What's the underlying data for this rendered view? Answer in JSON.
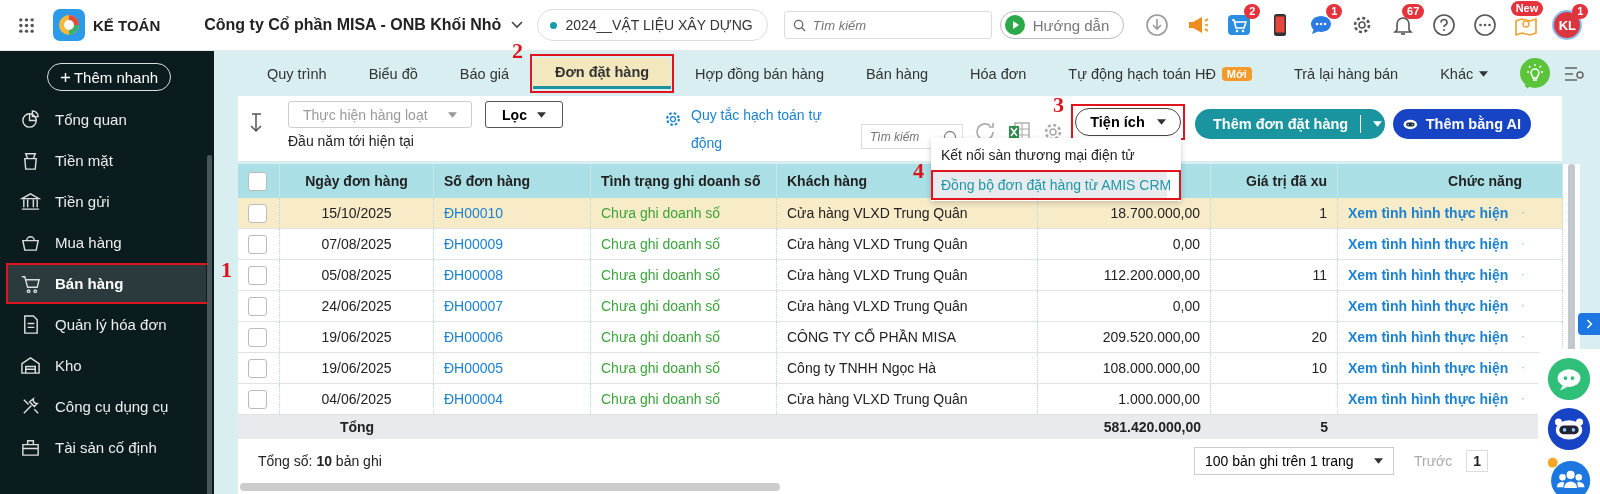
{
  "top_bar": {
    "app_name": "KẾ TOÁN",
    "company": "Công ty Cổ phần MISA - ONB Khối Nhỏ",
    "database": "2024__VẬT LIỆU XÂY DỰNG",
    "search": {
      "placeholder": "Tìm kiếm"
    },
    "guide_button": "Hướng dẫn",
    "icons": [
      {
        "kind": "download"
      },
      {
        "kind": "megaphone"
      },
      {
        "kind": "cart",
        "badge": "2"
      },
      {
        "kind": "phone"
      },
      {
        "kind": "chat",
        "badge": "1"
      },
      {
        "kind": "settings"
      },
      {
        "kind": "bell",
        "badge": "67"
      },
      {
        "kind": "help"
      },
      {
        "kind": "more"
      },
      {
        "kind": "map",
        "badge": "New"
      }
    ],
    "avatar": {
      "initials": "KL",
      "badge": "1"
    }
  },
  "sidebar": {
    "quick_add": "Thêm nhanh",
    "items": [
      {
        "label": "Tổng quan",
        "selected": false
      },
      {
        "label": "Tiền mặt",
        "selected": false
      },
      {
        "label": "Tiền gửi",
        "selected": false
      },
      {
        "label": "Mua hàng",
        "selected": false
      },
      {
        "label": "Bán hàng",
        "selected": true,
        "callout": "1"
      },
      {
        "label": "Quản lý hóa đơn",
        "selected": false
      },
      {
        "label": "Kho",
        "selected": false
      },
      {
        "label": "Công cụ dụng cụ",
        "selected": false
      },
      {
        "label": "Tài sản cố định",
        "selected": false
      }
    ]
  },
  "tabs": [
    {
      "label": "Quy trình",
      "kind": "tab",
      "selected": false
    },
    {
      "label": "Biểu đồ",
      "kind": "tab",
      "selected": false
    },
    {
      "label": "Báo giá",
      "kind": "tab",
      "selected": false
    },
    {
      "label": "Đơn đặt hàng",
      "kind": "tab",
      "selected": true,
      "callout": "2"
    },
    {
      "label": "Hợp đồng bán hàng",
      "kind": "tab",
      "selected": false
    },
    {
      "label": "Bán hàng",
      "kind": "tab",
      "selected": false
    },
    {
      "label": "Hóa đơn",
      "kind": "tab",
      "selected": false
    },
    {
      "label": "Tự động hạch toán HĐ",
      "kind": "tab",
      "selected": false,
      "badge": "Mới"
    },
    {
      "label": "Trả lại hàng bán",
      "kind": "tab",
      "selected": false
    },
    {
      "label": "Khác",
      "kind": "dropdown",
      "selected": false
    }
  ],
  "toolbar": {
    "bulk_action": {
      "label": "Thực hiện hàng loạt",
      "disabled": true
    },
    "filter": "Lọc",
    "period": "Đầu năm tới hiện tại",
    "rules_link": "Quy tắc hạch toán tự động",
    "search": {
      "placeholder": "Tìm kiếm"
    },
    "utilities": {
      "label": "Tiện ích",
      "callout": "3"
    },
    "add_button": "Thêm đơn đặt hàng",
    "ai_button": "Thêm bằng AI"
  },
  "utilities_menu": [
    {
      "label": "Kết nối sàn thương mại điện tử",
      "selected": false
    },
    {
      "label": "Đồng bộ đơn đặt hàng từ AMIS CRM",
      "selected": true,
      "callout": "4"
    }
  ],
  "table": {
    "header_checked": false,
    "columns": [
      {
        "label": "Ngày đơn hàng"
      },
      {
        "label": "Số đơn hàng"
      },
      {
        "label": "Tình trạng ghi doanh số"
      },
      {
        "label": "Khách hàng"
      },
      {},
      {
        "label": "Giá trị đã xu"
      },
      {
        "label": "Chức năng"
      }
    ],
    "rows": [
      {
        "checked": false,
        "selected": true,
        "date": "15/10/2025",
        "number": "ĐH00010",
        "status": "Chưa ghi doanh số",
        "customer": "Cửa hàng VLXD Trung Quân",
        "value": "18.700.000,00",
        "exported": "1",
        "action": "Xem tình hình thực hiện"
      },
      {
        "checked": false,
        "selected": false,
        "date": "07/08/2025",
        "number": "ĐH00009",
        "status": "Chưa ghi doanh số",
        "customer": "Cửa hàng VLXD Trung Quân",
        "value": "0,00",
        "action": "Xem tình hình thực hiện"
      },
      {
        "checked": false,
        "selected": false,
        "date": "05/08/2025",
        "number": "ĐH00008",
        "status": "Chưa ghi doanh số",
        "customer": "Cửa hàng VLXD Trung Quân",
        "value": "112.200.000,00",
        "exported": "11",
        "action": "Xem tình hình thực hiện"
      },
      {
        "checked": false,
        "selected": false,
        "date": "24/06/2025",
        "number": "ĐH00007",
        "status": "Chưa ghi doanh số",
        "customer": "Cửa hàng VLXD Trung Quân",
        "value": "0,00",
        "action": "Xem tình hình thực hiện"
      },
      {
        "checked": false,
        "selected": false,
        "date": "19/06/2025",
        "number": "ĐH00006",
        "status": "Chưa ghi doanh số",
        "customer": "CÔNG TY CỔ PHẦN MISA",
        "value": "209.520.000,00",
        "exported": "20",
        "action": "Xem tình hình thực hiện"
      },
      {
        "checked": false,
        "selected": false,
        "date": "19/06/2025",
        "number": "ĐH00005",
        "status": "Chưa ghi doanh số",
        "customer": "Công ty TNHH Ngọc Hà",
        "value": "108.000.000,00",
        "exported": "10",
        "action": "Xem tình hình thực hiện"
      },
      {
        "checked": false,
        "selected": false,
        "date": "04/06/2025",
        "number": "ĐH00004",
        "status": "Chưa ghi doanh số",
        "customer": "Cửa hàng VLXD Trung Quân",
        "value": "1.000.000,00",
        "action": "Xem tình hình thực hiện"
      }
    ],
    "totals": {
      "label": "Tổng",
      "value": "581.420.000,00",
      "exported": "5"
    }
  },
  "footer": {
    "count": "Tổng số: **10** bản ghi",
    "page_size": "100 bản ghi trên 1 trang",
    "prev": "Trước",
    "page": "1"
  }
}
